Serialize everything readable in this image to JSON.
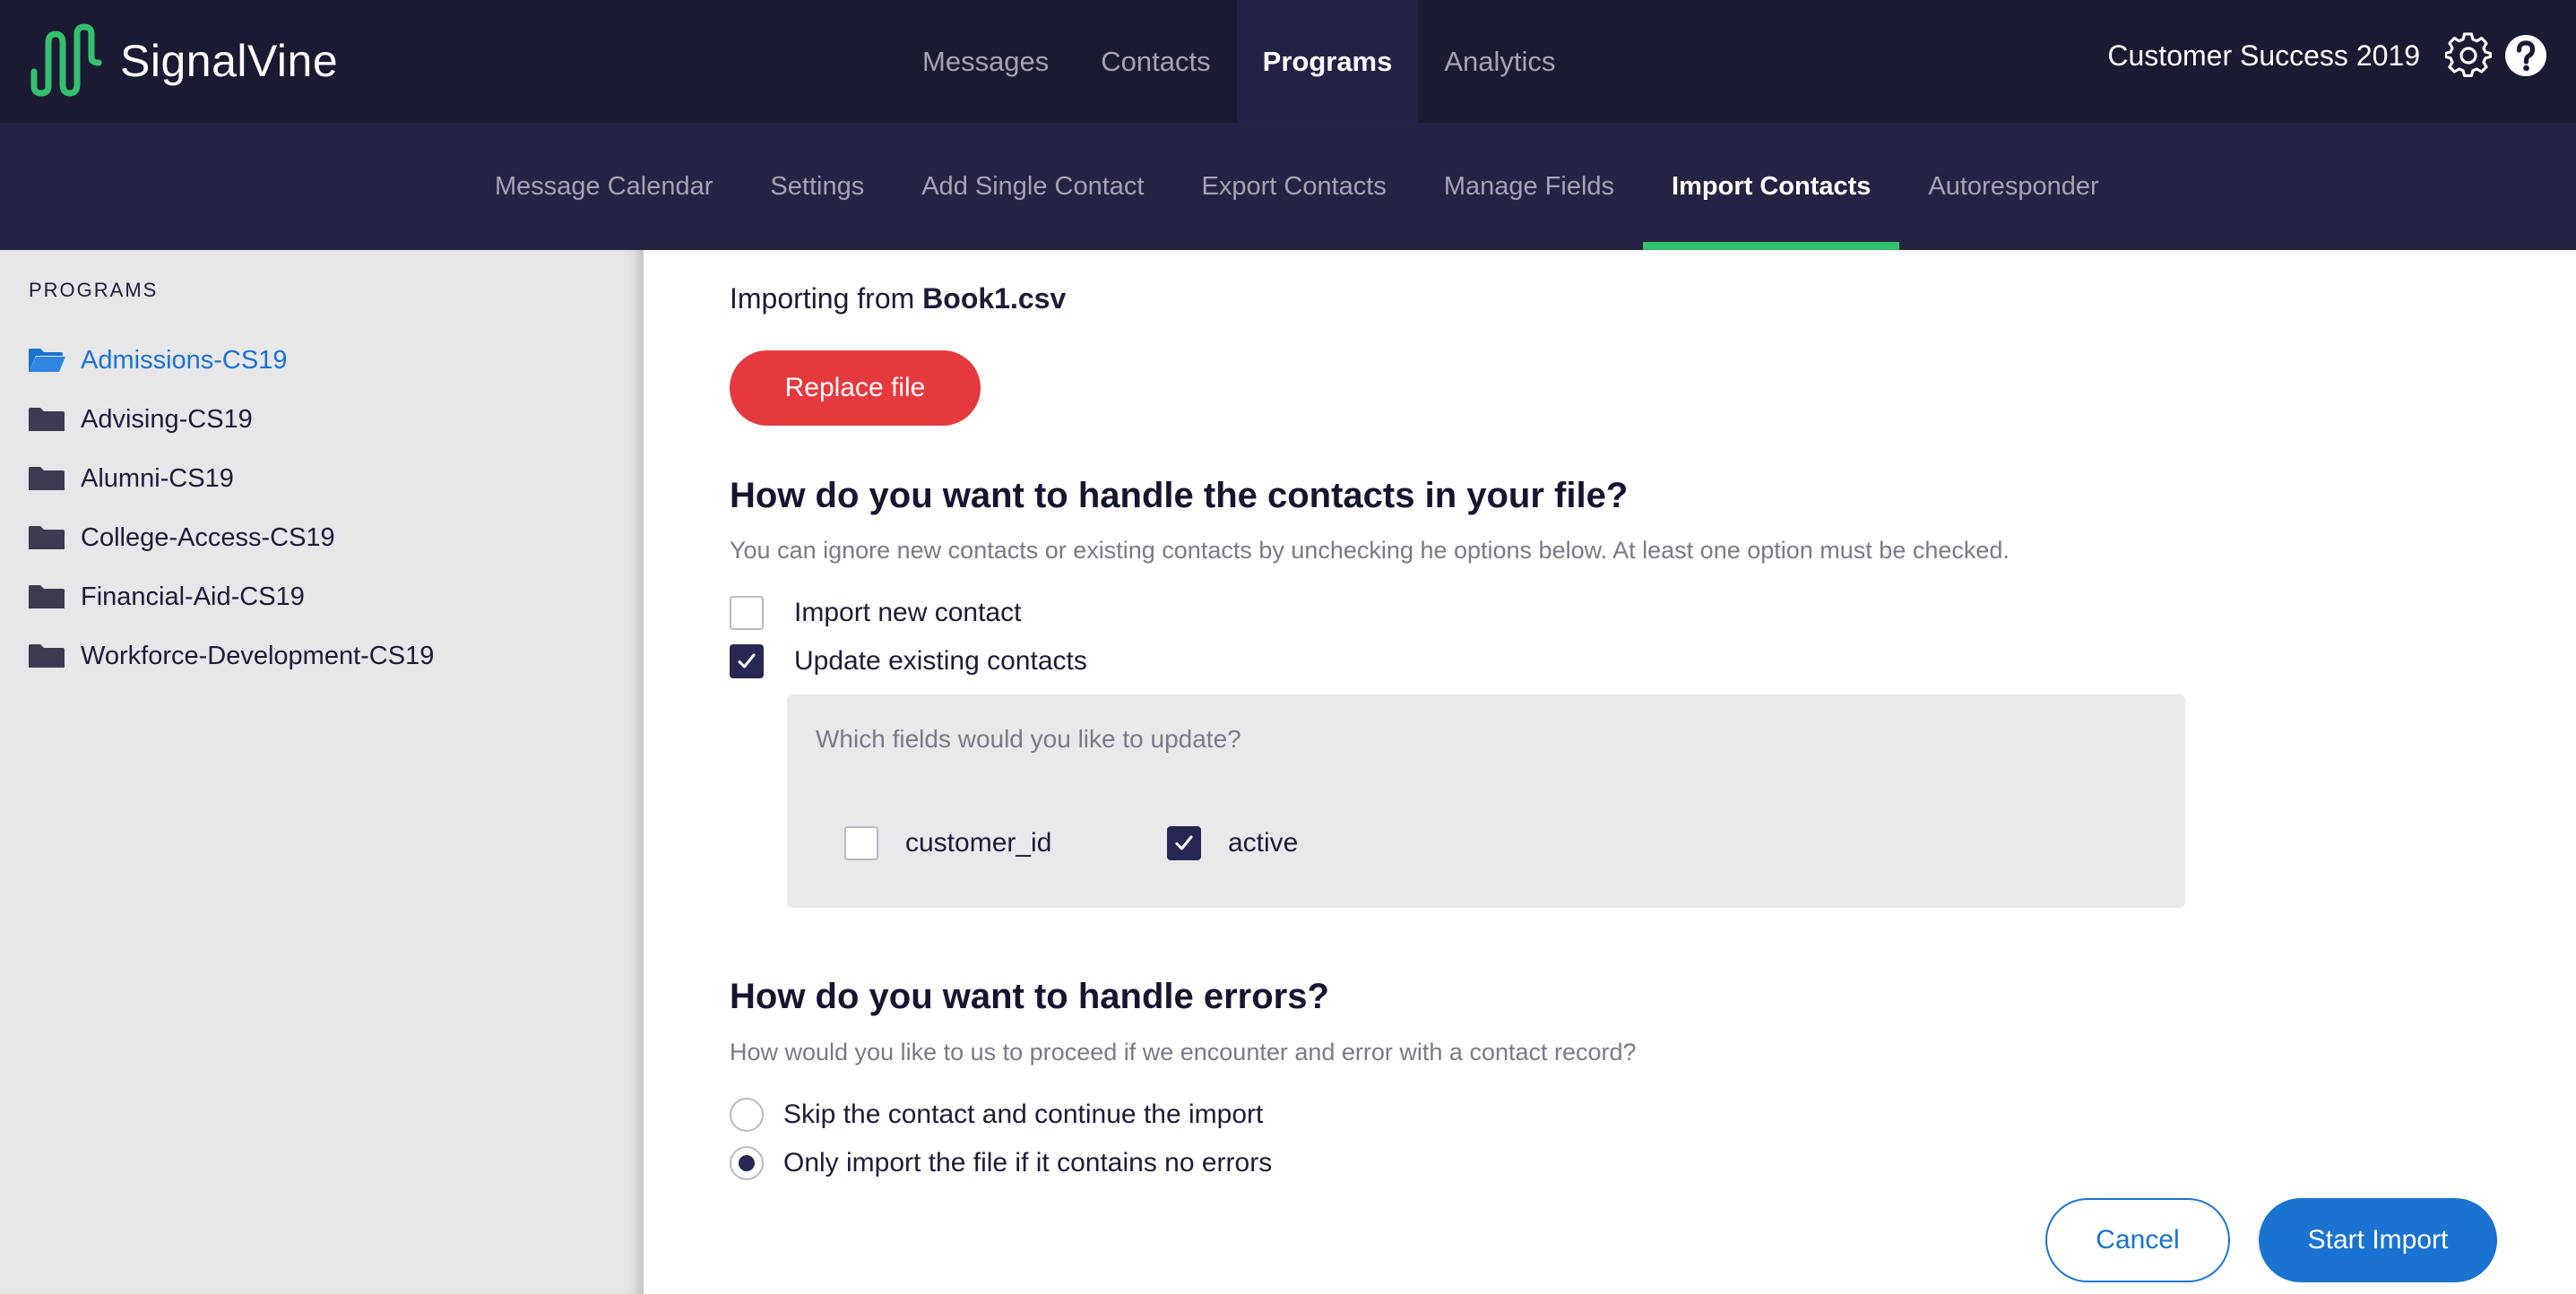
{
  "brand": {
    "name": "SignalVine",
    "logo_color": "#35c06e"
  },
  "main_nav": {
    "items": [
      {
        "label": "Messages",
        "active": false
      },
      {
        "label": "Contacts",
        "active": false
      },
      {
        "label": "Programs",
        "active": true
      },
      {
        "label": "Analytics",
        "active": false
      }
    ]
  },
  "header": {
    "workspace": "Customer Success 2019",
    "settings_icon": "gear-icon",
    "help_icon": "help-icon"
  },
  "sub_nav": {
    "items": [
      {
        "label": "Message Calendar",
        "active": false
      },
      {
        "label": "Settings",
        "active": false
      },
      {
        "label": "Add Single Contact",
        "active": false
      },
      {
        "label": "Export Contacts",
        "active": false
      },
      {
        "label": "Manage Fields",
        "active": false
      },
      {
        "label": "Import Contacts",
        "active": true
      },
      {
        "label": "Autoresponder",
        "active": false
      }
    ],
    "active_indicator_color": "#35c06e"
  },
  "sidebar": {
    "heading": "PROGRAMS",
    "items": [
      {
        "label": "Admissions-CS19",
        "active": true
      },
      {
        "label": "Advising-CS19",
        "active": false
      },
      {
        "label": "Alumni-CS19",
        "active": false
      },
      {
        "label": "College-Access-CS19",
        "active": false
      },
      {
        "label": "Financial-Aid-CS19",
        "active": false
      },
      {
        "label": "Workforce-Development-CS19",
        "active": false
      }
    ]
  },
  "import": {
    "importing_prefix": "Importing from",
    "file_name": "Book1.csv",
    "replace_label": "Replace file"
  },
  "contacts_section": {
    "title": "How do you want to handle the contacts in your file?",
    "description": "You can ignore new contacts or existing contacts by unchecking he options below. At least one option must be checked.",
    "options": [
      {
        "label": "Import new contact",
        "checked": false
      },
      {
        "label": "Update existing contacts",
        "checked": true
      }
    ],
    "fields_question": "Which fields would you like to update?",
    "fields": [
      {
        "label": "customer_id",
        "checked": false
      },
      {
        "label": "active",
        "checked": true
      }
    ]
  },
  "errors_section": {
    "title": "How do you want to handle errors?",
    "description": "How would you like to us to proceed if we encounter and error with a contact record?",
    "options": [
      {
        "label": "Skip the contact and continue the import",
        "selected": false
      },
      {
        "label": "Only import the file if it contains no errors",
        "selected": true
      }
    ]
  },
  "actions": {
    "cancel_label": "Cancel",
    "start_label": "Start Import"
  },
  "colors": {
    "primary": "#1a73d0",
    "danger": "#e5393e",
    "nav_bg": "#1b1a33",
    "subnav_bg": "#252343"
  }
}
